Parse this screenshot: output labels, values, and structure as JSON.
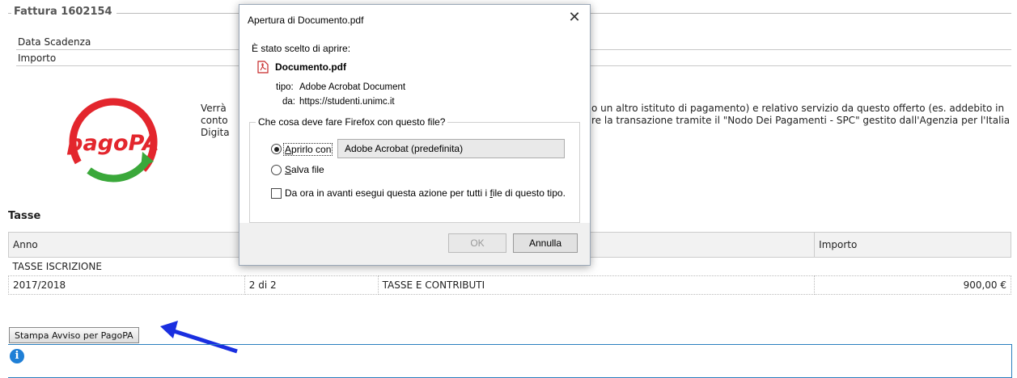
{
  "invoice": {
    "title": "Fattura 1602154",
    "rows": [
      {
        "label": "Data Scadenza"
      },
      {
        "label": "Importo"
      }
    ]
  },
  "intro": {
    "line1_left": "Verrà",
    "line2_left": "conto",
    "line3_left": "Digita",
    "line1_right": "o un altro istituto di pagamento) e relativo servizio da questo offerto (es. addebito in",
    "line2_right": "re la transazione tramite il \"Nodo Dei Pagamenti - SPC\" gestito dall'Agenzia per l'Italia"
  },
  "logo": {
    "text": "pagoPA"
  },
  "tasse": {
    "title": "Tasse",
    "headers": [
      "Anno",
      "",
      "",
      "Importo"
    ],
    "group": "TASSE ISCRIZIONE",
    "rows": [
      {
        "anno": "2017/2018",
        "rata": "2 di 2",
        "descrizione": "TASSE E CONTRIBUTI",
        "importo": "900,00 €"
      }
    ]
  },
  "print_button": "Stampa Avviso per PagoPA",
  "dialog": {
    "title": "Apertura di Documento.pdf",
    "close": "✕",
    "chosen": "È stato scelto di aprire:",
    "filename": "Documento.pdf",
    "type_label": "tipo:",
    "type_value": "Adobe Acrobat Document",
    "from_label": "da:",
    "from_value": "https://studenti.unimc.it",
    "question": "Che cosa deve fare Firefox con questo file?",
    "open_with_prefix": "A",
    "open_with_rest": "prirlo con",
    "open_with_app": "Adobe Acrobat  (predefinita)",
    "save_prefix": "S",
    "save_rest": "alva file",
    "remember_a": "Da ora in avanti esegui questa azione per tutti i ",
    "remember_u": "f",
    "remember_b": "ile di questo tipo.",
    "ok": "OK",
    "cancel": "Annulla"
  },
  "colors": {
    "arrow": "#1a2fe0",
    "logo_red": "#e3262d",
    "logo_green": "#3aa83a",
    "info_blue": "#1f7fd6"
  }
}
